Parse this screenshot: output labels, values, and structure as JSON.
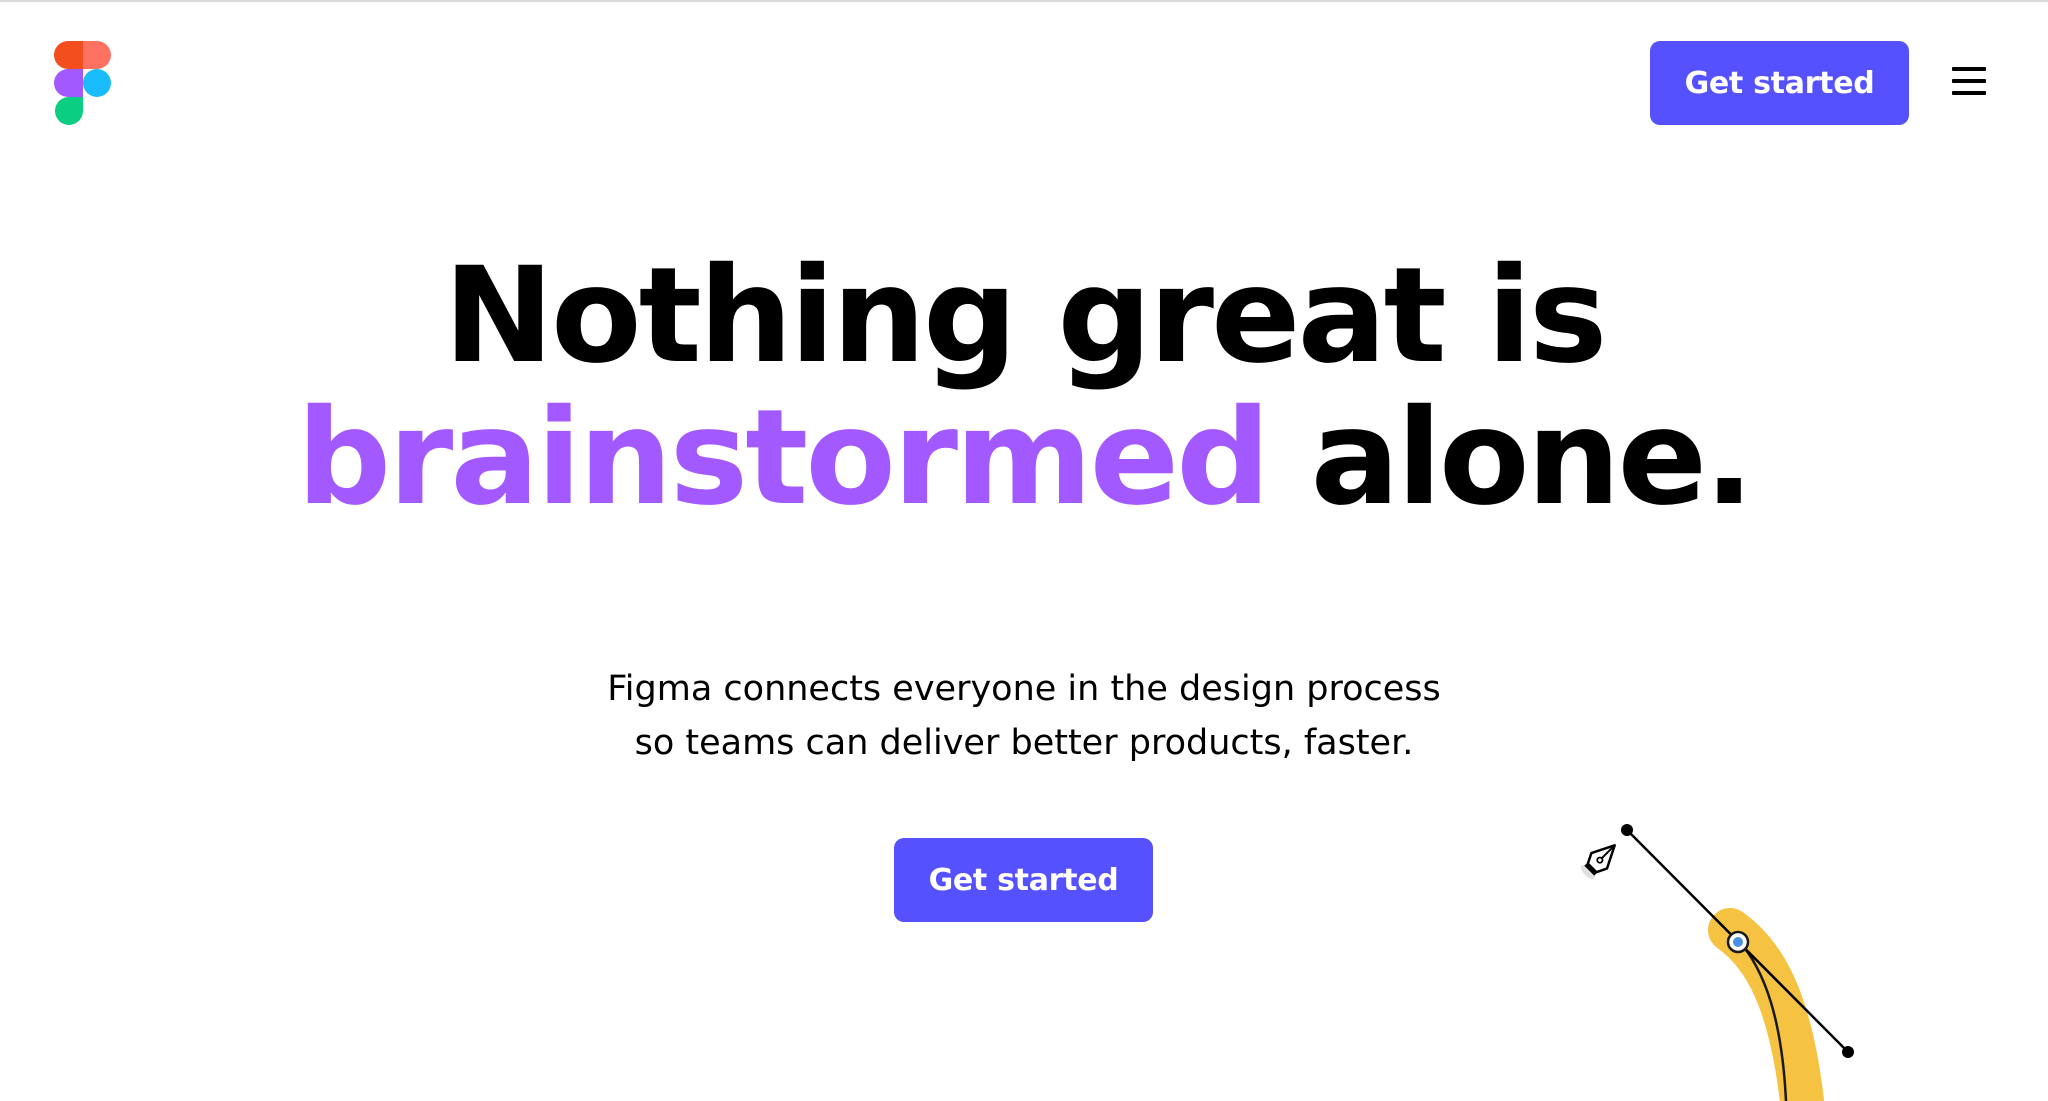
{
  "header": {
    "logo_icon": "figma-logo",
    "cta_label": "Get started",
    "menu_icon": "hamburger-menu-icon"
  },
  "hero": {
    "headline_line1": "Nothing great is",
    "headline_accent": "brainstormed",
    "headline_rest": "alone.",
    "subhead_line1": "Figma connects everyone in the design process",
    "subhead_line2": "so teams can deliver better products, faster.",
    "cta_label": "Get started"
  },
  "illustration": {
    "tool_icon": "pen-tool-icon"
  },
  "colors": {
    "primary_button": "#5551ff",
    "accent_text": "#a259ff",
    "illustration_stroke": "#f5c242"
  }
}
